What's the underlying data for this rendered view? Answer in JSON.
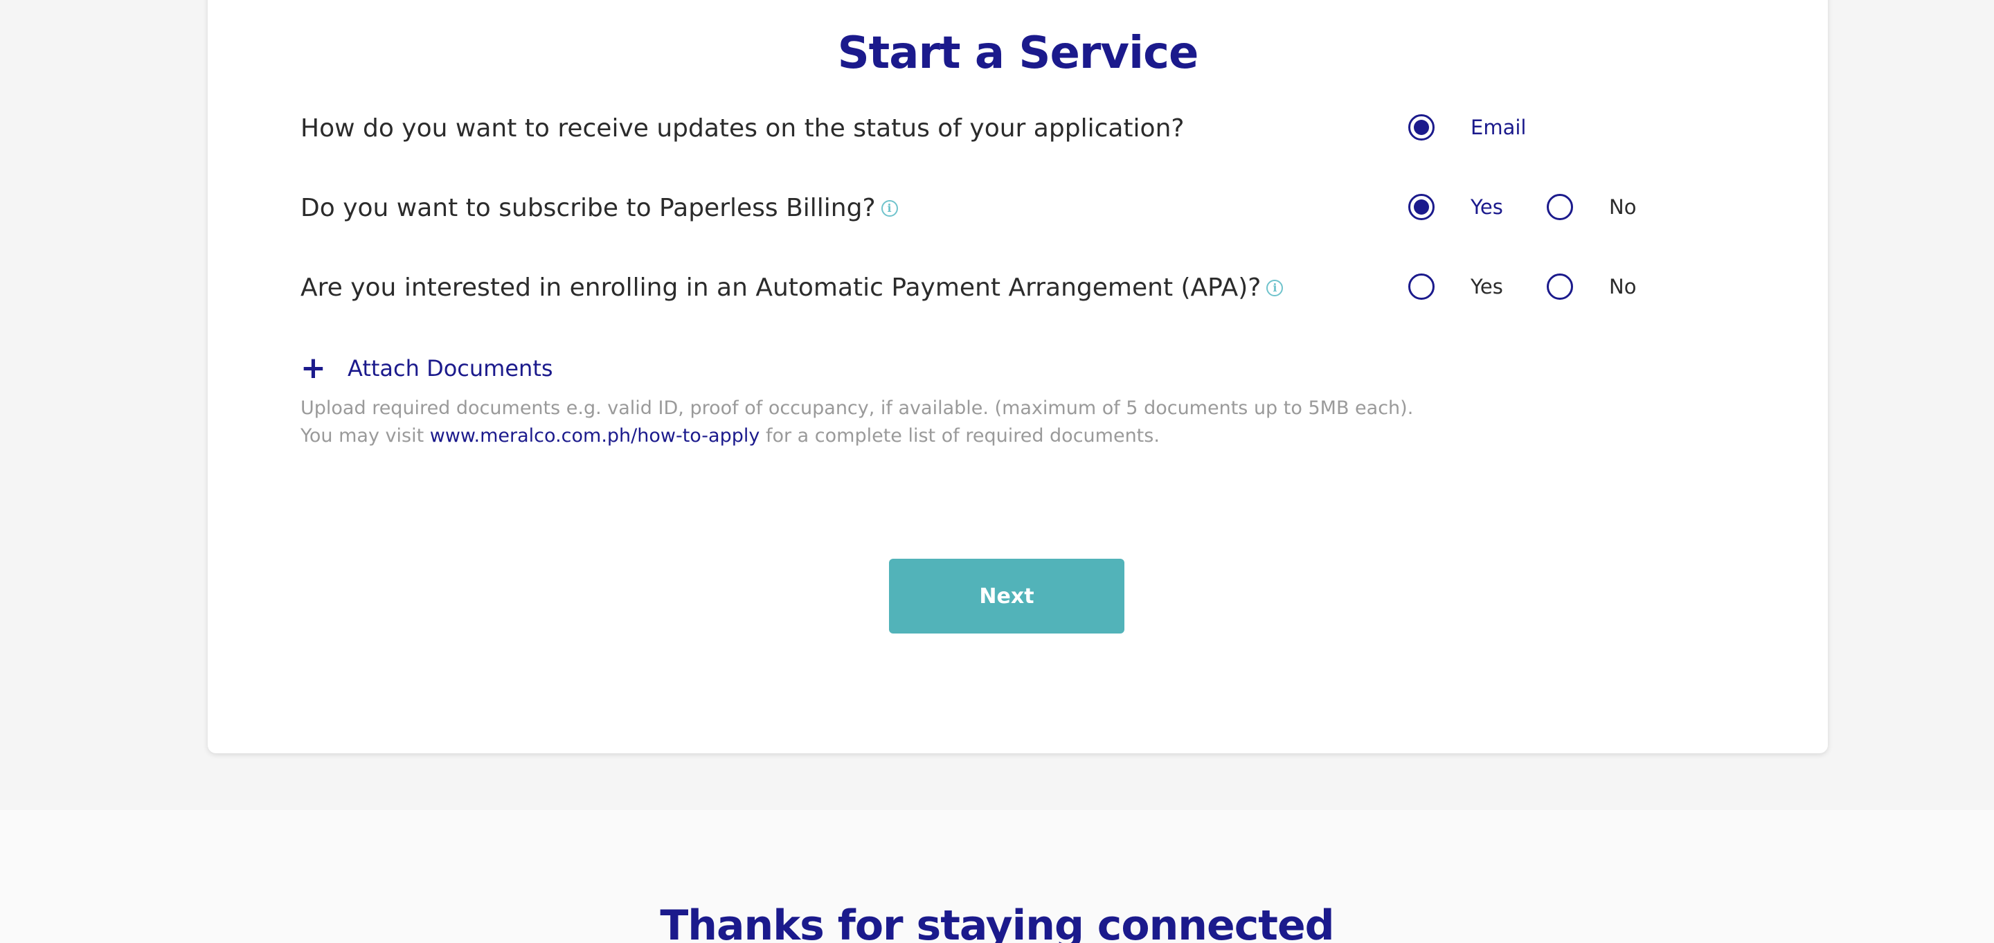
{
  "form": {
    "title": "Start a Service",
    "questions": [
      {
        "text": "How do you want to receive updates on the status of your application?",
        "options": [
          {
            "label": "Email",
            "selected": true
          }
        ]
      },
      {
        "text": "Do you want to subscribe to Paperless Billing?",
        "info_icon": "info-icon",
        "options": [
          {
            "label": "Yes",
            "selected": true
          },
          {
            "label": "No",
            "selected": false
          }
        ]
      },
      {
        "text": "Are you interested in enrolling in an Automatic Payment Arrangement (APA)?",
        "info_icon": "info-icon",
        "options": [
          {
            "label": "Yes",
            "selected": false
          },
          {
            "label": "No",
            "selected": false
          }
        ]
      }
    ],
    "attach": {
      "icon": "plus-icon",
      "label": "Attach Documents"
    },
    "help": {
      "line1": "Upload required documents e.g. valid ID, proof of occupancy, if available. (maximum of 5 documents up to 5MB each).",
      "line2_prefix": "You may visit",
      "link": "www.meralco.com.ph/how-to-apply",
      "line2_suffix": "for a complete list of required documents."
    },
    "next_label": "Next"
  },
  "footer": {
    "title": "Thanks for staying connected"
  },
  "colors": {
    "brand": "#1b1a8c",
    "button": "#52b3b9",
    "info": "#6fc3cc",
    "help_text": "#9a9a9a"
  }
}
